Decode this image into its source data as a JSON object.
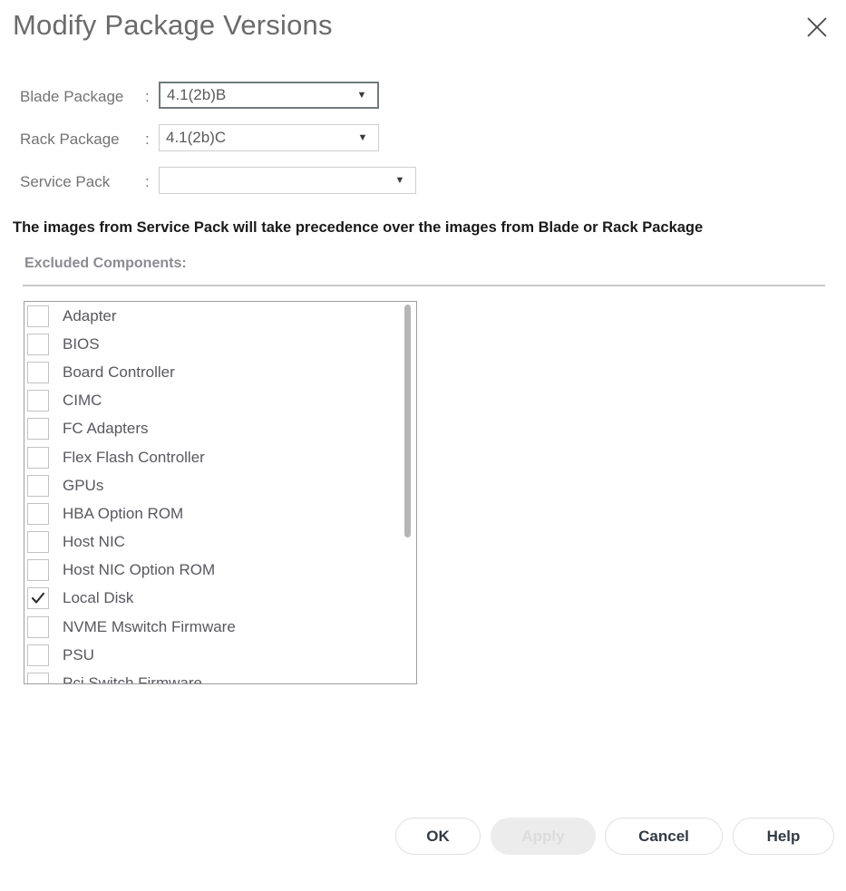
{
  "dialog": {
    "title": "Modify Package Versions",
    "close_icon": "close-icon"
  },
  "form": {
    "colon": ":",
    "rows": [
      {
        "label": "Blade Package",
        "value": "4.1(2b)B",
        "placeholder": "",
        "arrow": "▼",
        "focused": true
      },
      {
        "label": "Rack Package",
        "value": "4.1(2b)C",
        "placeholder": "",
        "arrow": "▼",
        "focused": false
      },
      {
        "label": "Service Pack",
        "value": "",
        "placeholder": "",
        "arrow": "▼",
        "focused": false
      }
    ]
  },
  "precedence_note": "The images from Service Pack will take precedence over the images from Blade or Rack Package",
  "excluded": {
    "header": "Excluded Components:",
    "items": [
      {
        "label": "Adapter",
        "checked": false
      },
      {
        "label": "BIOS",
        "checked": false
      },
      {
        "label": "Board Controller",
        "checked": false
      },
      {
        "label": "CIMC",
        "checked": false
      },
      {
        "label": "FC Adapters",
        "checked": false
      },
      {
        "label": "Flex Flash Controller",
        "checked": false
      },
      {
        "label": "GPUs",
        "checked": false
      },
      {
        "label": "HBA Option ROM",
        "checked": false
      },
      {
        "label": "Host NIC",
        "checked": false
      },
      {
        "label": "Host NIC Option ROM",
        "checked": false
      },
      {
        "label": "Local Disk",
        "checked": true
      },
      {
        "label": "NVME Mswitch Firmware",
        "checked": false
      },
      {
        "label": "PSU",
        "checked": false
      },
      {
        "label": "Pci Switch Firmware",
        "checked": false
      }
    ]
  },
  "footer": {
    "ok_label": "OK",
    "apply_label": "Apply",
    "cancel_label": "Cancel",
    "help_label": "Help"
  },
  "colors": {
    "title_text": "#6b6b6b",
    "label_text": "#737373",
    "note_text": "#1a1a1a",
    "focus_border": "#707b7b",
    "button_text": "#333a45",
    "disabled_button_bg": "#ececec"
  }
}
